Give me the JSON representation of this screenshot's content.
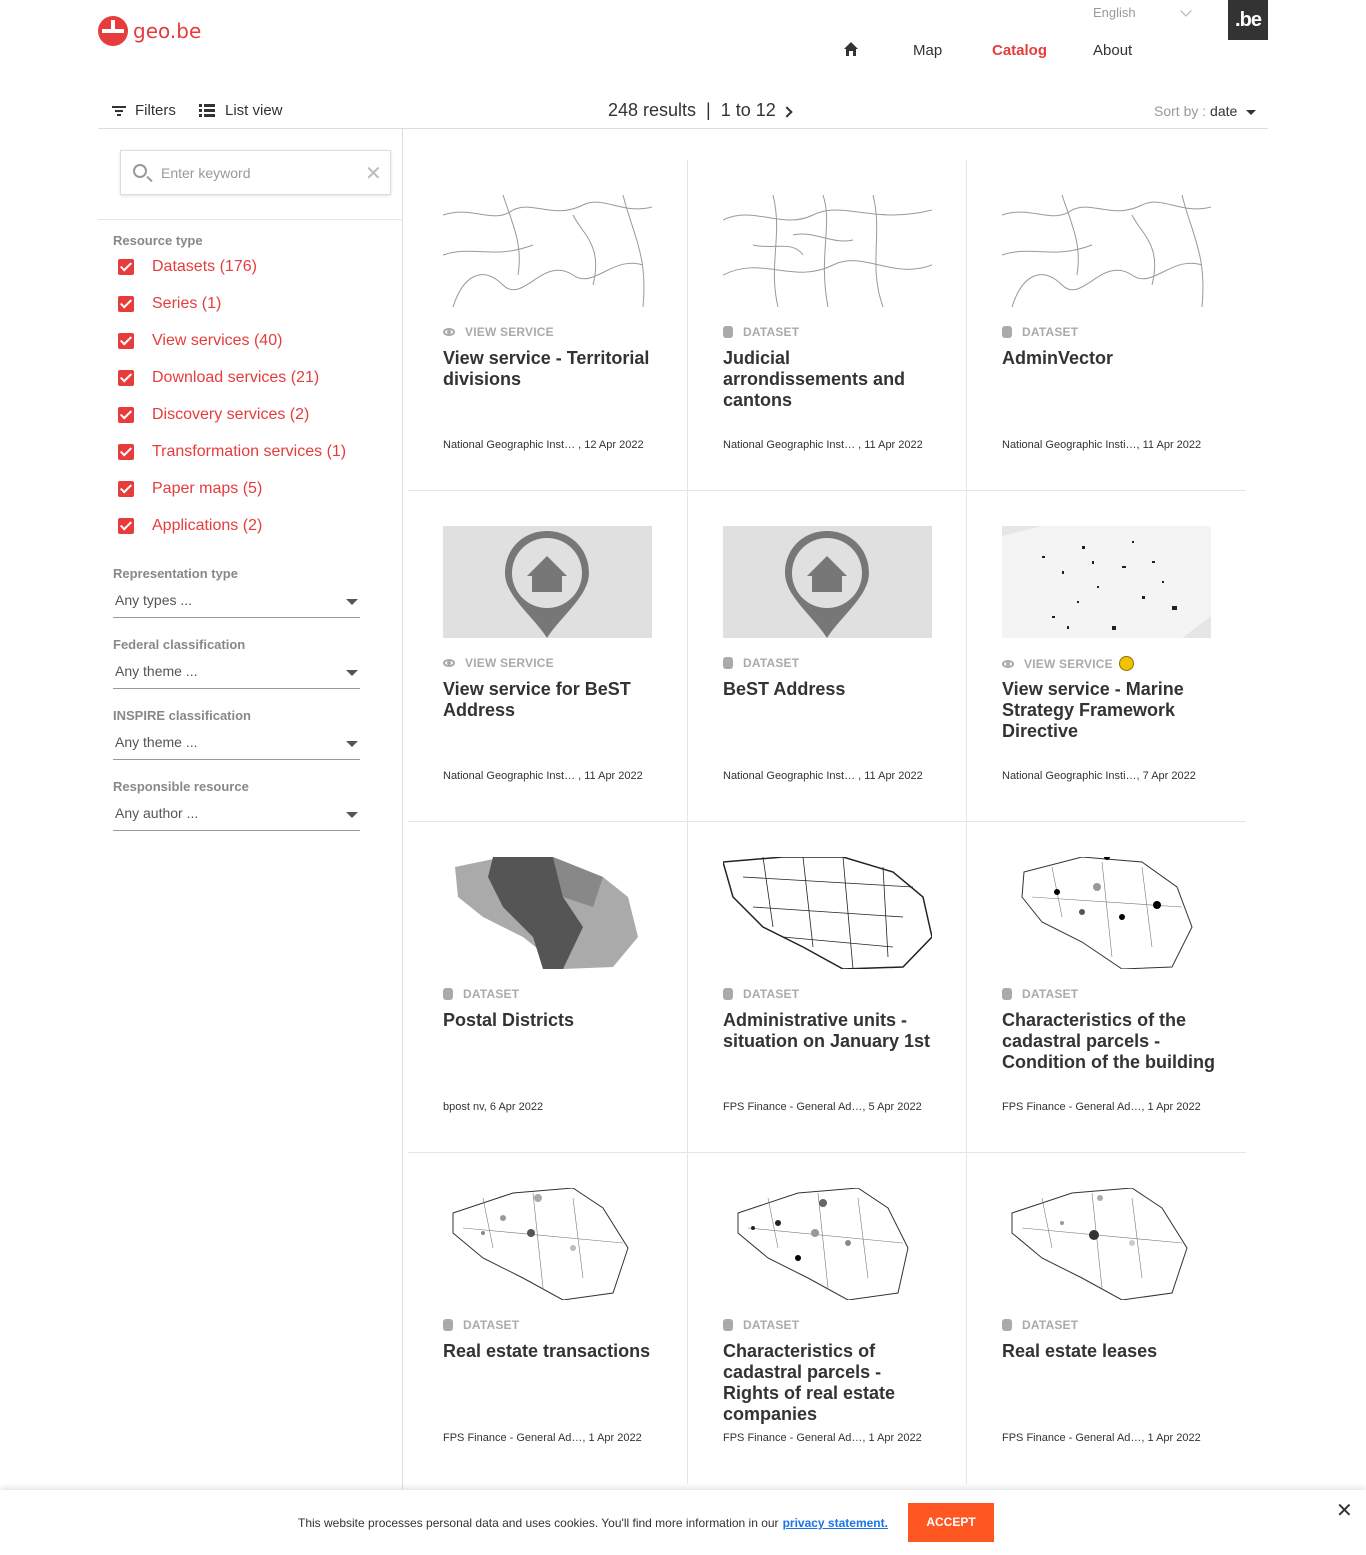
{
  "header": {
    "logo_text": "geo.be",
    "language": "English",
    "badge": ".be",
    "nav": [
      "Map",
      "Catalog",
      "About"
    ]
  },
  "toolbar": {
    "filters": "Filters",
    "list_view": "List view",
    "results": "248 results  |  1 to 12",
    "sort_label": "Sort by : ",
    "sort_value": "date"
  },
  "search": {
    "placeholder": "Enter keyword"
  },
  "facets": {
    "resource_type_title": "Resource type",
    "resource_types": [
      "Datasets (176)",
      "Series (1)",
      "View services (40)",
      "Download services (21)",
      "Discovery services (2)",
      "Transformation services (1)",
      "Paper maps (5)",
      "Applications (2)"
    ],
    "representation_title": "Representation type",
    "representation_value": "Any types ...",
    "federal_title": "Federal classification",
    "federal_value": "Any theme ...",
    "inspire_title": "INSPIRE classification",
    "inspire_value": "Any theme ...",
    "responsible_title": "Responsible resource",
    "responsible_value": "Any author ..."
  },
  "cards": [
    {
      "type": "VIEW SERVICE",
      "title": "View service - Territorial divisions",
      "meta": "National Geographic Inst… , 12 Apr 2022"
    },
    {
      "type": "DATASET",
      "title": "Judicial arrondissements and cantons",
      "meta": "National Geographic Inst… , 11 Apr 2022"
    },
    {
      "type": "DATASET",
      "title": "AdminVector",
      "meta": "National Geographic Insti…, 11 Apr 2022"
    },
    {
      "type": "VIEW SERVICE",
      "title": "View service for BeST Address",
      "meta": "National Geographic Inst… , 11 Apr 2022"
    },
    {
      "type": "DATASET",
      "title": "BeST Address",
      "meta": "National Geographic Inst… , 11 Apr 2022"
    },
    {
      "type": "VIEW SERVICE",
      "title": "View service - Marine Strategy Framework Directive",
      "meta": "National Geographic Insti…, 7 Apr 2022"
    },
    {
      "type": "DATASET",
      "title": "Postal Districts",
      "meta": "bpost nv, 6 Apr 2022"
    },
    {
      "type": "DATASET",
      "title": "Administrative units - situation on January 1st",
      "meta": "FPS Finance - General Ad…, 5 Apr 2022"
    },
    {
      "type": "DATASET",
      "title": "Characteristics of the cadastral parcels - Condition of the building",
      "meta": "FPS Finance - General Ad…, 1 Apr 2022"
    },
    {
      "type": "DATASET",
      "title": "Real estate transactions",
      "meta": "FPS Finance - General Ad…, 1 Apr 2022"
    },
    {
      "type": "DATASET",
      "title": "Characteristics of cadastral parcels - Rights of real estate companies",
      "meta": "FPS Finance - General Ad…, 1 Apr 2022"
    },
    {
      "type": "DATASET",
      "title": "Real estate leases",
      "meta": "FPS Finance - General Ad…, 1 Apr 2022"
    }
  ],
  "cookie": {
    "text": "This website processes personal data and uses cookies. You'll find more information in our",
    "link": "privacy statement.",
    "accept": "ACCEPT"
  },
  "colors": {
    "accent": "#e63c3c",
    "accept": "#ff5722"
  }
}
